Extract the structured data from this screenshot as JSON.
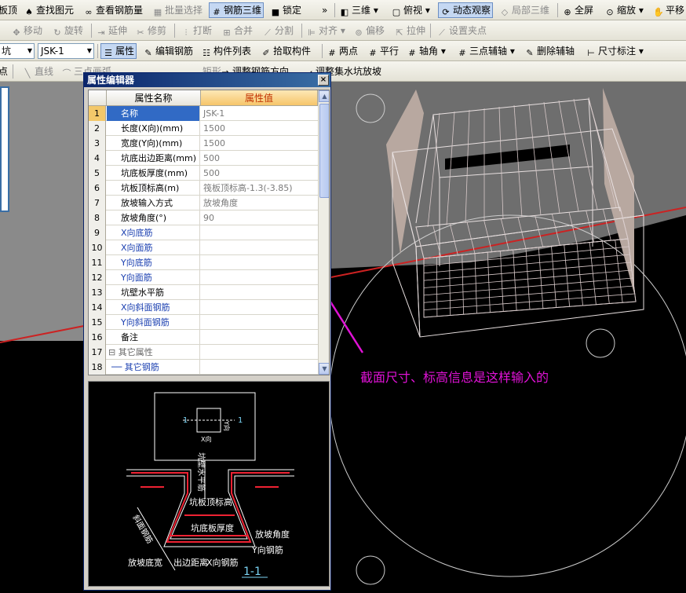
{
  "toolbar1": {
    "items": [
      "板顶",
      "查找图元",
      "查看钢筋量",
      "批量选择",
      "钢筋三维",
      "锁定",
      "»",
      "三维",
      "俯视",
      "动态观察",
      "局部三维",
      "全屏",
      "缩放",
      "平移"
    ]
  },
  "toolbar2": {
    "items": [
      "移动",
      "旋转",
      "延伸",
      "修剪",
      "打断",
      "合并",
      "分割",
      "对齐",
      "偏移",
      "拉伸",
      "设置夹点"
    ]
  },
  "toolbar3": {
    "component_type": "坑",
    "component_name": "JSK-1",
    "items": [
      "属性",
      "编辑钢筋",
      "构件列表",
      "拾取构件",
      "两点",
      "平行",
      "轴角",
      "三点辅轴",
      "删除辅轴",
      "尺寸标注"
    ]
  },
  "toolbar4": {
    "items": [
      "点",
      "直线",
      "三点画弧",
      "矩形",
      "调整钢筋方向",
      "调整集水坑放坡"
    ]
  },
  "dialog": {
    "title": "属性编辑器",
    "close": "×",
    "col_name": "属性名称",
    "col_value": "属性值",
    "rows": [
      {
        "n": "1",
        "name": "名称",
        "value": "JSK-1"
      },
      {
        "n": "2",
        "name": "长度(X向)(mm)",
        "value": "1500"
      },
      {
        "n": "3",
        "name": "宽度(Y向)(mm)",
        "value": "1500"
      },
      {
        "n": "4",
        "name": "坑底出边距离(mm)",
        "value": "500"
      },
      {
        "n": "5",
        "name": "坑底板厚度(mm)",
        "value": "500"
      },
      {
        "n": "6",
        "name": "坑板顶标高(m)",
        "value": "筏板顶标高-1.3(-3.85)"
      },
      {
        "n": "7",
        "name": "放坡输入方式",
        "value": "放坡角度"
      },
      {
        "n": "8",
        "name": "放坡角度(°)",
        "value": "90"
      },
      {
        "n": "9",
        "name": "X向底筋",
        "value": ""
      },
      {
        "n": "10",
        "name": "X向面筋",
        "value": ""
      },
      {
        "n": "11",
        "name": "Y向底筋",
        "value": ""
      },
      {
        "n": "12",
        "name": "Y向面筋",
        "value": ""
      },
      {
        "n": "13",
        "name": "坑壁水平筋",
        "value": ""
      },
      {
        "n": "14",
        "name": "X向斜面钢筋",
        "value": ""
      },
      {
        "n": "15",
        "name": "Y向斜面钢筋",
        "value": ""
      },
      {
        "n": "16",
        "name": "备注",
        "value": ""
      },
      {
        "n": "17",
        "name": "其它属性",
        "value": ""
      },
      {
        "n": "18",
        "name": "其它钢筋",
        "value": ""
      }
    ]
  },
  "preview": {
    "section_mark": "1",
    "x_dir": "X向",
    "y_dir": "Y向",
    "wall_bar": "坑壁水平筋",
    "top_elev": "坑板顶标高",
    "bottom_thick": "坑底板厚度",
    "slope_angle": "放坡角度",
    "slope_bar": "斜面钢筋",
    "y_bar": "Y向钢筋",
    "x_bar": "X向钢筋",
    "slope_bottom": "放坡底宽",
    "out_dist": "出边距离",
    "section_title": "1-1"
  },
  "annotation": {
    "text": "截面尺寸、标高信息是这样输入的",
    "color": "#e012d6"
  }
}
